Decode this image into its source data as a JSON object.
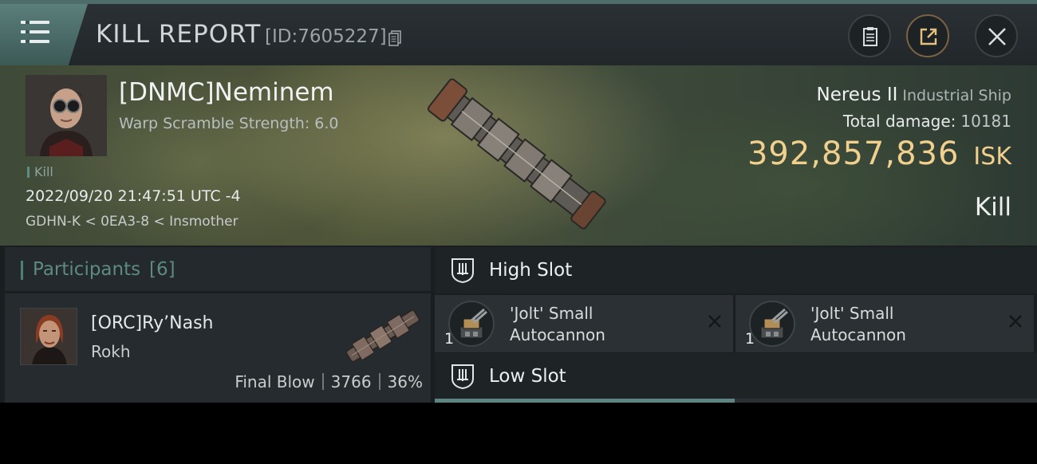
{
  "header": {
    "title": "KILL REPORT",
    "report_id": "[ID:7605227]",
    "icons": {
      "menu": "hamburger-menu-icon",
      "copy": "copy-icon",
      "clipboard": "clipboard-icon",
      "share": "share-icon",
      "close": "close-icon"
    }
  },
  "victim": {
    "name": "[DNMC]Neminem",
    "warp_scramble": "Warp Scramble Strength: 6.0",
    "kill_tag": "Kill",
    "timestamp": "2022/09/20 21:47:51 UTC -4",
    "location": "GDHN-K < 0EA3-8 < Insmother",
    "ship_name": "Nereus II",
    "ship_class": "Industrial Ship",
    "damage_label": "Total damage:",
    "damage_value": "10181",
    "isk_value": "392,857,836",
    "isk_unit": "ISK",
    "kill_type": "Kill"
  },
  "participants": {
    "title": "Participants",
    "count": "[6]",
    "list": [
      {
        "name": "[ORC]Ry’Nash",
        "ship": "Rokh",
        "blow": "Final Blow",
        "damage": "3766",
        "percent": "36%"
      }
    ]
  },
  "fitting": {
    "high_slot_label": "High Slot",
    "low_slot_label": "Low Slot",
    "modules": [
      {
        "qty": "1",
        "name": "'Jolt' Small Autocannon"
      },
      {
        "qty": "1",
        "name": "'Jolt' Small Autocannon"
      }
    ]
  },
  "colors": {
    "accent": "#5d8682",
    "isk": "#f1cf8d",
    "background": "#1a1e21"
  }
}
